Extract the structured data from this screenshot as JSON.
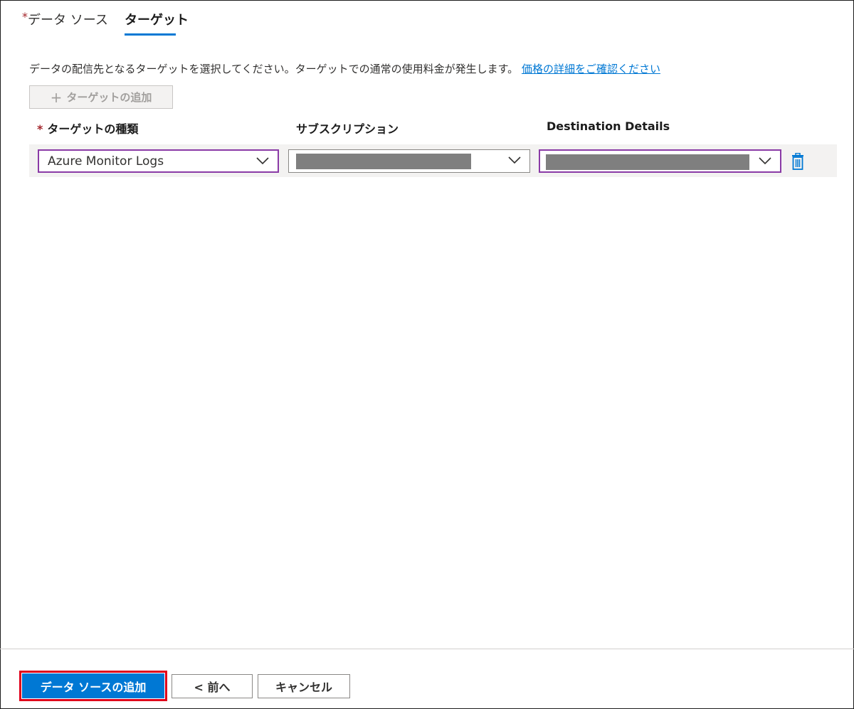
{
  "tabs": {
    "datasource": {
      "required_mark": "*",
      "label": "データ ソース"
    },
    "target": {
      "label": "ターゲット"
    }
  },
  "description": {
    "text": "データの配信先となるターゲットを選択してください。ターゲットでの通常の使用料金が発生します。",
    "link": "価格の詳細をご確認ください"
  },
  "add_target_button": {
    "icon": "+",
    "label": "ターゲットの追加"
  },
  "columns": {
    "type": {
      "required_mark": "*",
      "label": "ターゲットの種類"
    },
    "subscription": {
      "label": "サブスクリプション"
    },
    "destination": {
      "label": "Destination Details"
    }
  },
  "row": {
    "type_value": "Azure Monitor Logs"
  },
  "footer": {
    "add_datasource": "データ ソースの追加",
    "prev": "< 前へ",
    "cancel": "キャンセル"
  },
  "colors": {
    "accent": "#0078d4",
    "required": "#a4262c",
    "focus_border": "#8a3aa6",
    "highlight": "#e0001b"
  }
}
